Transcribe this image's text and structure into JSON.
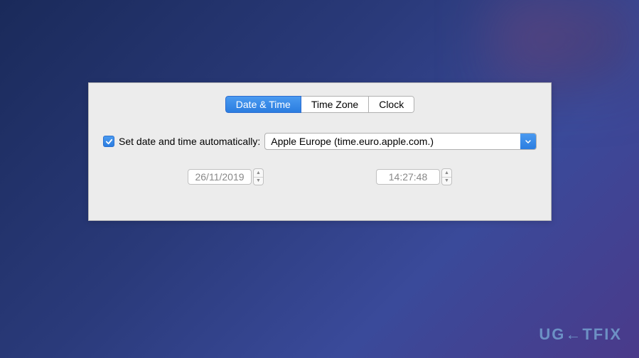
{
  "tabs": {
    "date_time": "Date & Time",
    "time_zone": "Time Zone",
    "clock": "Clock"
  },
  "auto_time": {
    "label": "Set date and time automatically:",
    "server": "Apple Europe (time.euro.apple.com.)"
  },
  "date_value": "26/11/2019",
  "time_value": "14:27:48",
  "watermark": "UG←TFIX"
}
